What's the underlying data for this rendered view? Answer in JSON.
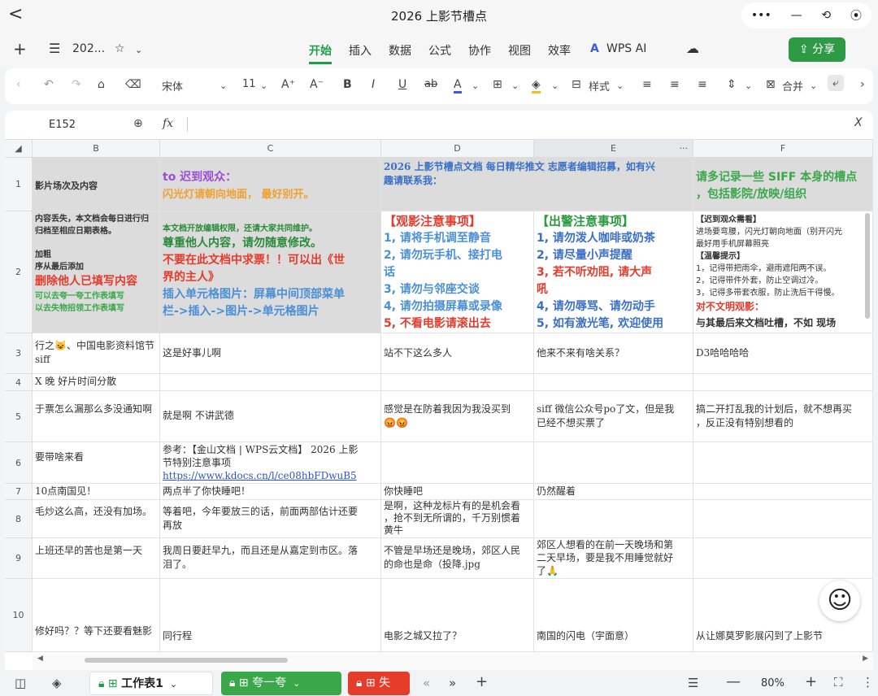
{
  "window": {
    "back": "<",
    "title": "2026 上影节槽点",
    "controls": [
      "•••",
      "—",
      "⟲",
      "⦿"
    ]
  },
  "menubar": {
    "doc_name": "202...",
    "tabs": [
      "开始",
      "插入",
      "数据",
      "公式",
      "协作",
      "视图",
      "效率"
    ],
    "ai": "WPS AI",
    "share": "分享"
  },
  "toolbar": {
    "font": "宋体",
    "size": "11",
    "style": "样式",
    "merge": "合并"
  },
  "formula": {
    "cell": "E152",
    "fx": "fx"
  },
  "columns": [
    "B",
    "C",
    "D",
    "E",
    "F"
  ],
  "rows": {
    "r1": {
      "num": "1",
      "b": "影片场次及内容",
      "c1": "to 迟到观众：",
      "c2": "闪光灯请朝向地面， 最好别开。",
      "d1": "2026 上影节槽点文档 每日精华推文 志愿者编辑招募，如有兴",
      "d2": "趣请联系我：",
      "f1": "请多记录一些 SIFF 本身的槽点",
      "f2": "，包括影院/放映/组织"
    },
    "r2": {
      "num": "2",
      "b": [
        "内容丢失，本文档会每日进行归",
        "归档至相应日期表格。",
        "",
        "加粗",
        "序从最后添加",
        "删除他人已填写内容",
        "可以去夸一夸工作表填写",
        "以去失物招领工作表填写"
      ],
      "c": [
        "本文档开放编辑权限，还请大家共同维护。",
        "尊重他人内容，请勿随意修改。",
        "不要在此文档中求票！！可以出《世",
        "界的主人》",
        "插入单元格图片：屏幕中间顶部菜单",
        "栏->插入->图片->单元格图片"
      ],
      "d": [
        "【观影注意事项】",
        "1, 请将手机调至静音",
        "2, 请勿玩手机、接打电",
        "话",
        "3, 请勿与邻座交谈",
        "4, 请勿拍摄屏幕或录像",
        "5, 不看电影请滚出去"
      ],
      "e": [
        "【出警注意事项】",
        "1, 请勿泼人咖啡或奶茶",
        "2, 请尽量小声提醒",
        "3, 若不听劝阻, 请大声",
        "吼",
        "4, 请勿辱骂、请勿动手",
        "5, 如有激光笔, 欢迎使用"
      ],
      "f": [
        "【迟到观众需看】",
        "进场要弯腰，闪光灯朝向地面（别开闪光",
        "最好用手机屏幕照亮",
        "【温馨提示】",
        "1，记得带把雨伞，避雨遮阳两不误。",
        "2，记得带件外套，防止空调过冷。",
        "3，记得多带套衣服，防止洗后干得慢。",
        "对不文明观影：",
        "与其最后来文档吐槽，不如 现场"
      ]
    },
    "r3": {
      "num": "3",
      "b1": "行之😺、中国电影资料馆节",
      "b2": "siff",
      "c": "这是好事儿啊",
      "d": "站不下这么多人",
      "e": "他来不来有啥关系？",
      "f": "D3哈哈哈哈"
    },
    "r4": {
      "num": "4",
      "b": "X 晚  好片时间分散"
    },
    "r5": {
      "num": "5",
      "b": "于票怎么漏那么多没通知啊",
      "c": "就是啊 不讲武德",
      "d1": "感觉是在防着我因为我没买到",
      "d2": "😡😡",
      "e1": "siff 微信公众号po了文，但是我",
      "e2": "已经不想买票了",
      "f1": "搞二开打乱我的计划后，就不想再买",
      "f2": "，反正没有特别想看的"
    },
    "r6": {
      "num": "6",
      "b": "要带啥来看",
      "c1": "参考：【金山文档 | WPS云文档】 2026 上影",
      "c2": "节特别注意事项",
      "c3": "https://www.kdocs.cn/l/ce08hbFDwuB5"
    },
    "r7": {
      "num": "7",
      "b": "10点南国见！",
      "c": "两点半了你快睡吧！",
      "d": "你快睡吧",
      "e": "仍然醒着"
    },
    "r8": {
      "num": "8",
      "b": "毛炒这么高，还没有加场。",
      "c1": "等着吧，今年要放三的话，前面两部估计还要",
      "c2": "再放",
      "d1": "是啊，这种龙标片有的是机会看",
      "d2": "，抢不到无所谓的，千万别惯着",
      "d3": "黄牛"
    },
    "r9": {
      "num": "9",
      "b": "上班还早的苦也是第一天",
      "c1": "我周日要赶早九，而且还是从嘉定到市区。落",
      "c2": "泪了。",
      "d1": "不管是早场还是晚场，郊区人民",
      "d2": "的命也是命（投降.jpg",
      "e1": "郊区人想看的在前一天晚场和第",
      "e2": "二天早场，要是我不用睡觉就好",
      "e3": "了🙏"
    },
    "r10": {
      "num": "10",
      "b": "修好吗？？等下还要看魅影",
      "c": "同行程",
      "d": "电影之城又拉了？",
      "e": "南国的闪电（宇面意）",
      "f": "从让娜莫罗影展闪到了上影节"
    }
  },
  "bottom": {
    "sheet1": "工作表1",
    "sheet2": "夸一夸",
    "sheet3": "失",
    "zoom": "80%"
  },
  "colors": {
    "accent": "#1f9d47",
    "red": "#e53b2b",
    "purple": "#9b4dd8",
    "orange": "#f0a030",
    "blue": "#4a8fd8"
  }
}
